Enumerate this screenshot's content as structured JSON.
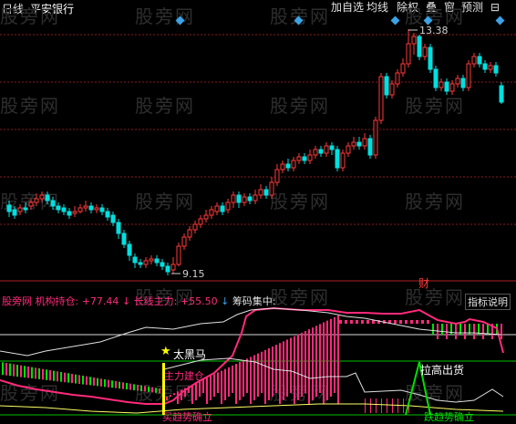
{
  "header": {
    "period": "日线",
    "stock_name": "平安银行"
  },
  "toolbar": {
    "add_self_select": "加自选",
    "ma_line": "均线",
    "ex_right": "除权",
    "overlay": "叠",
    "window": "窗",
    "forecast": "预测",
    "close_glyph": "⊟"
  },
  "price_chart": {
    "high_label": "13.38",
    "low_label": "9.15",
    "marker_label": "财"
  },
  "indicator_bar": {
    "name": "股旁网",
    "inst_label": "机构持仓:",
    "inst_value": "+77.44",
    "long_label": "长线主力:",
    "long_value": "+55.50",
    "chip_label": "筹码集中:",
    "help_button": "指标说明"
  },
  "annotations": {
    "star_label": "太黑马",
    "buy_label": "主力建仓",
    "bottom_left": "买趋势确立",
    "sell_label": "拉高出货",
    "bottom_right": "跌趋势确立"
  },
  "watermark": "股旁网",
  "colors": {
    "up": "#ff3a3a",
    "down": "#00e0e0",
    "accent_blue": "#3ba3e6",
    "magenta": "#ff2a7a",
    "yellow": "#ffff00",
    "green": "#00e000"
  }
}
